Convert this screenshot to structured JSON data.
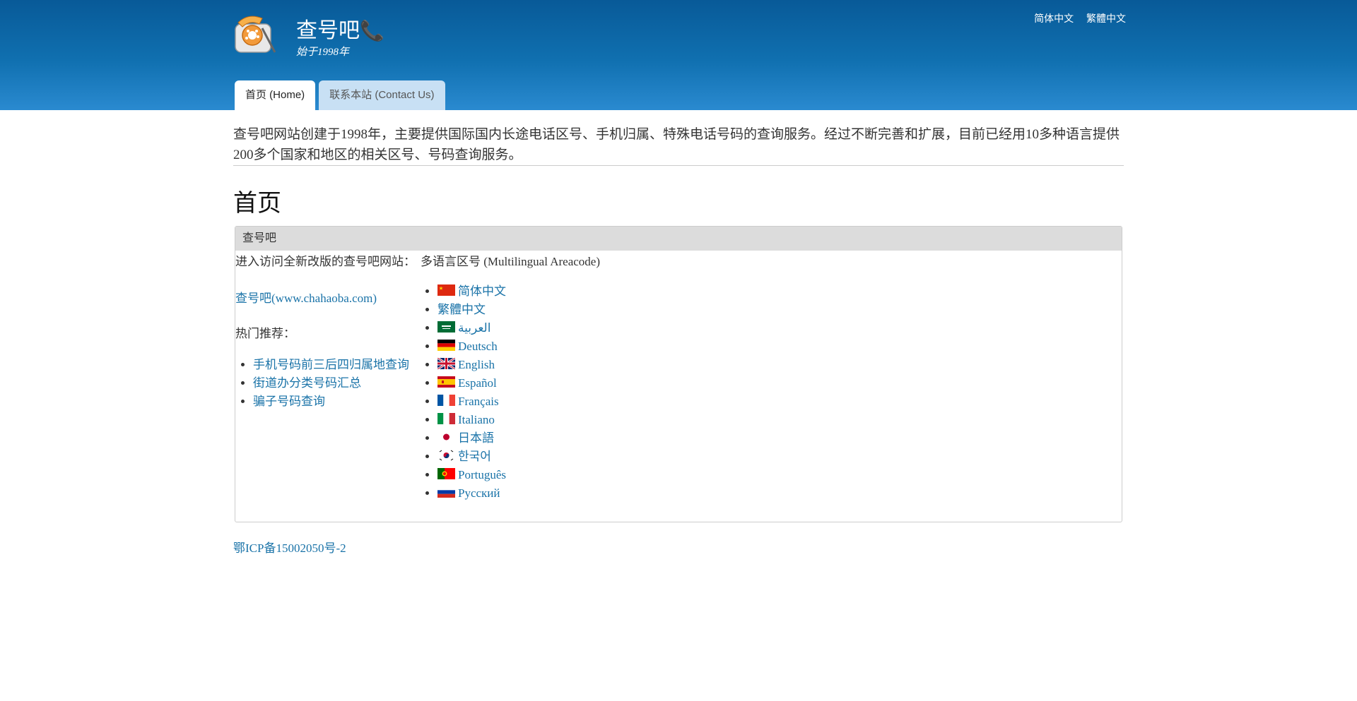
{
  "header": {
    "site_name": "查号吧",
    "phone_glyph": "📞",
    "slogan": "始于1998年",
    "lang_links": [
      "简体中文",
      "繁體中文"
    ],
    "tabs": [
      {
        "label": "首页 (Home)",
        "active": true
      },
      {
        "label": "联系本站 (Contact Us)",
        "active": false
      }
    ]
  },
  "intro": "查号吧网站创建于1998年，主要提供国际国内长途电话区号、手机归属、特殊电话号码的查询服务。经过不断完善和扩展，目前已经用10多种语言提供200多个国家和地区的相关区号、号码查询服务。",
  "page_title": "首页",
  "panel": {
    "heading": "查号吧",
    "left": {
      "visit_label": "进入访问全新改版的查号吧网站：",
      "site_link": "查号吧(www.chahaoba.com)",
      "hot_label": "热门推荐：",
      "hot_links": [
        "手机号码前三后四归属地查询",
        "街道办分类号码汇总",
        "骗子号码查询"
      ]
    },
    "right": {
      "label": "多语言区号 (Multilingual Areacode)",
      "languages": [
        {
          "name": "简体中文",
          "flag": "cn"
        },
        {
          "name": "繁體中文",
          "flag": ""
        },
        {
          "name": "العربية",
          "flag": "sa"
        },
        {
          "name": "Deutsch",
          "flag": "de"
        },
        {
          "name": "English",
          "flag": "gb"
        },
        {
          "name": "Español",
          "flag": "es"
        },
        {
          "name": "Français",
          "flag": "fr"
        },
        {
          "name": "Italiano",
          "flag": "it"
        },
        {
          "name": "日本語",
          "flag": "jp"
        },
        {
          "name": "한국어",
          "flag": "kr"
        },
        {
          "name": "Português",
          "flag": "pt"
        },
        {
          "name": "Русский",
          "flag": "ru"
        }
      ]
    }
  },
  "footer": {
    "icp": "鄂ICP备15002050号-2"
  }
}
